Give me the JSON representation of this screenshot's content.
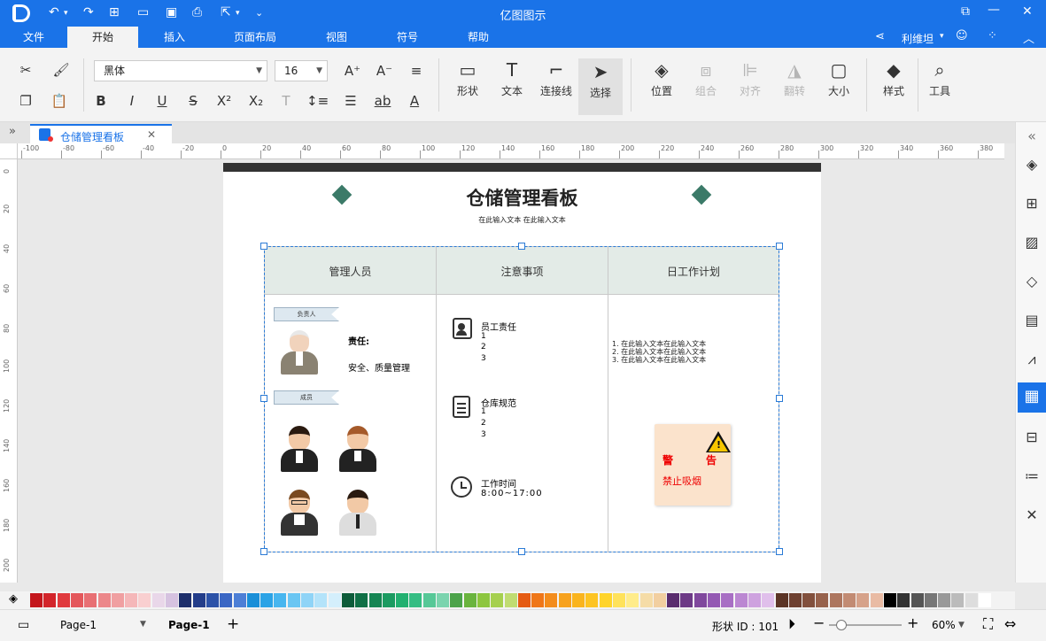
{
  "app": {
    "title": "亿图图示",
    "user": "利维坦"
  },
  "menu": [
    "文件",
    "开始",
    "插入",
    "页面布局",
    "视图",
    "符号",
    "帮助"
  ],
  "toolbar": {
    "font_name": "黑体",
    "font_size": "16",
    "big_buttons": [
      {
        "label": "形状",
        "icon": "shape-icon",
        "disabled": false
      },
      {
        "label": "文本",
        "icon": "text-icon",
        "disabled": false
      },
      {
        "label": "连接线",
        "icon": "connector-icon",
        "disabled": false
      },
      {
        "label": "选择",
        "icon": "select-icon",
        "disabled": false
      },
      {
        "label": "位置",
        "icon": "position-icon",
        "disabled": false
      },
      {
        "label": "组合",
        "icon": "group-icon",
        "disabled": true
      },
      {
        "label": "对齐",
        "icon": "align-icon",
        "disabled": true
      },
      {
        "label": "翻转",
        "icon": "flip-icon",
        "disabled": true
      },
      {
        "label": "大小",
        "icon": "size-icon",
        "disabled": false
      },
      {
        "label": "样式",
        "icon": "style-icon",
        "disabled": false
      },
      {
        "label": "工具",
        "icon": "tools-icon",
        "disabled": false
      }
    ]
  },
  "doc_tab": {
    "label": "仓储管理看板"
  },
  "ruler": {
    "h_ticks": [
      "-100",
      "-80",
      "-60",
      "-40",
      "-20",
      "0",
      "20",
      "40",
      "60",
      "80",
      "100",
      "120",
      "140",
      "160",
      "180",
      "200",
      "220",
      "240",
      "260",
      "280",
      "300",
      "320",
      "340",
      "360",
      "380"
    ],
    "v_ticks": [
      "0",
      "20",
      "40",
      "60",
      "80",
      "100",
      "120",
      "140",
      "160",
      "180",
      "200"
    ]
  },
  "board": {
    "title": "仓储管理看板",
    "subtitle": "在此输入文本 在此输入文本",
    "columns": [
      "管理人员",
      "注意事项",
      "日工作计划"
    ],
    "manager": {
      "tag_leader": "负责人",
      "responsibility_label": "责任:",
      "responsibility_text": "安全、质量管理",
      "tag_member": "成员"
    },
    "notices": [
      {
        "title": "员工责任",
        "lines": [
          "1",
          "2",
          "3"
        ]
      },
      {
        "title": "仓库规范",
        "lines": [
          "1",
          "2",
          "3"
        ]
      },
      {
        "title": "工作时间",
        "lines": [
          "8:00~17:00"
        ]
      }
    ],
    "plan": [
      "1. 在此输入文本在此输入文本",
      "2. 在此输入文本在此输入文本",
      "3. 在此输入文本在此输入文本"
    ],
    "warning": {
      "word1": "警",
      "word2": "告",
      "text": "禁止吸烟"
    }
  },
  "status": {
    "page_selector": "Page-1",
    "page_tab": "Page-1",
    "shape_id": "形状 ID : 101",
    "zoom": "60%"
  },
  "palette": [
    "#c4161c",
    "#d3242a",
    "#e03a3e",
    "#e4575b",
    "#e86f73",
    "#ec878a",
    "#f09fa1",
    "#f5b7b9",
    "#f9cfd0",
    "#e9d7e9",
    "#d6c2e0",
    "#1e2f6b",
    "#233d8a",
    "#2c52a8",
    "#3a66c4",
    "#4d7fd6",
    "#1a8fd8",
    "#2ba3e6",
    "#48b6ef",
    "#6ac6f3",
    "#8fd4f7",
    "#b3e3fa",
    "#d4effc",
    "#0d5c3a",
    "#107046",
    "#158553",
    "#1b9b61",
    "#22b070",
    "#35bd83",
    "#56c897",
    "#7bd4ae",
    "#4ca34a",
    "#6ab43e",
    "#8dc63f",
    "#a6d04f",
    "#c0dc72",
    "#e55b13",
    "#ef7618",
    "#f38c1c",
    "#f7a21e",
    "#fab41d",
    "#fdc422",
    "#ffd42a",
    "#ffe25a",
    "#ffec8a",
    "#f5dca7",
    "#f2cfa0",
    "#5a2d6e",
    "#6d3a86",
    "#80489d",
    "#9459b3",
    "#a86fc4",
    "#bb87d2",
    "#cea2df",
    "#e0bfeb",
    "#5b3425",
    "#6e4030",
    "#82503d",
    "#97624c",
    "#ad765f",
    "#c28b73",
    "#d6a28a",
    "#e9bba4",
    "#000000",
    "#333333",
    "#555555",
    "#777777",
    "#999999",
    "#bbbbbb",
    "#dddddd",
    "#ffffff"
  ]
}
